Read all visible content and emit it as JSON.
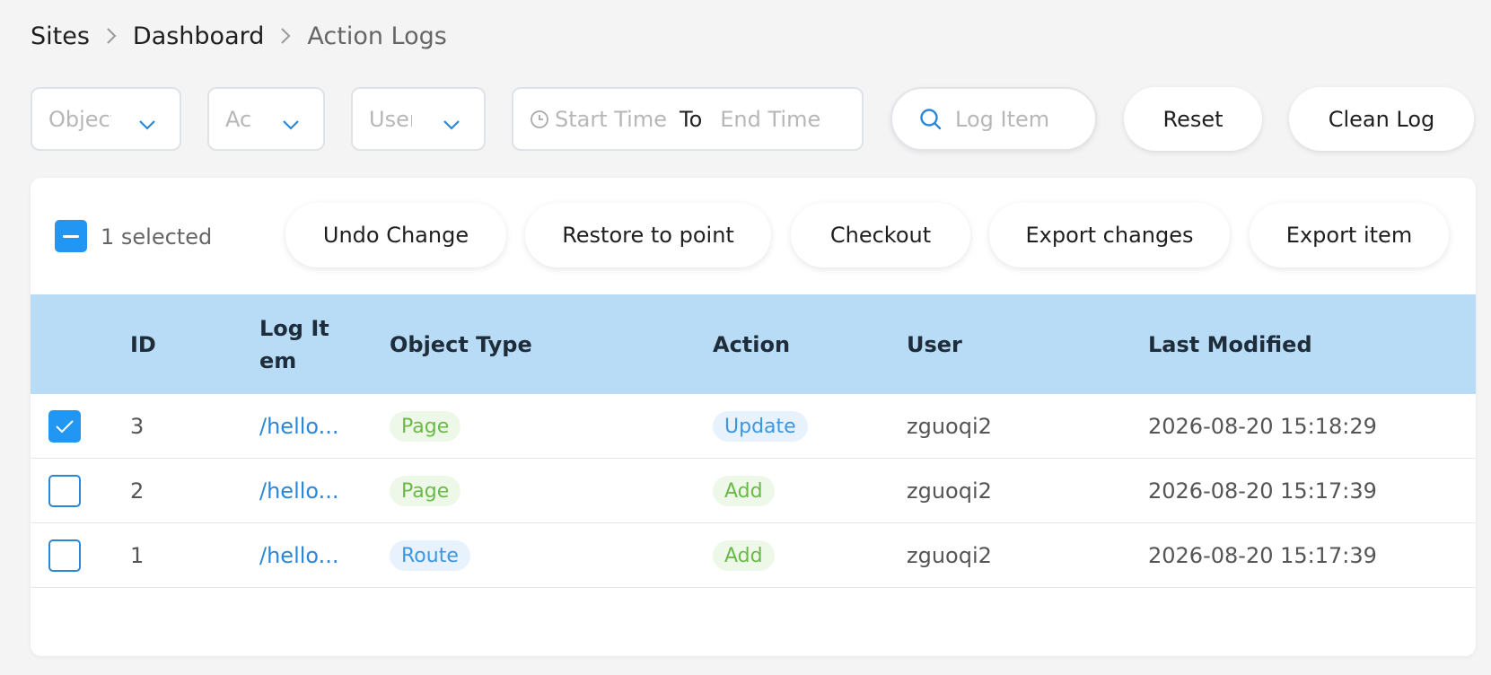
{
  "breadcrumb": {
    "items": [
      "Sites",
      "Dashboard",
      "Action Logs"
    ]
  },
  "filters": {
    "object_type_placeholder": "Object Type",
    "action_placeholder": "Action",
    "user_placeholder": "User",
    "start_time_placeholder": "Start Time",
    "range_separator": "To",
    "end_time_placeholder": "End Time",
    "search_placeholder": "Log Item",
    "reset_label": "Reset",
    "clean_log_label": "Clean Log"
  },
  "selection": {
    "text": "1 selected"
  },
  "actions": {
    "undo_change": "Undo Change",
    "restore_to_point": "Restore to point",
    "checkout": "Checkout",
    "export_changes": "Export changes",
    "export_item": "Export item"
  },
  "table": {
    "columns": {
      "id": "ID",
      "log_item": "Log Item",
      "object_type": "Object Type",
      "action": "Action",
      "user": "User",
      "last_modified": "Last Modified"
    },
    "rows": [
      {
        "checked": true,
        "id": "3",
        "log_item": "/hello...",
        "object_type": "Page",
        "object_type_color": "green",
        "action": "Update",
        "action_color": "blue",
        "user": "zguoqi2",
        "last_modified": "2026-08-20 15:18:29"
      },
      {
        "checked": false,
        "id": "2",
        "log_item": "/hello...",
        "object_type": "Page",
        "object_type_color": "green",
        "action": "Add",
        "action_color": "green",
        "user": "zguoqi2",
        "last_modified": "2026-08-20 15:17:39"
      },
      {
        "checked": false,
        "id": "1",
        "log_item": "/hello...",
        "object_type": "Route",
        "object_type_color": "blue",
        "action": "Add",
        "action_color": "green",
        "user": "zguoqi2",
        "last_modified": "2026-08-20 15:17:39"
      }
    ]
  },
  "colors": {
    "accent": "#2196f3",
    "link": "#2b87d8",
    "header_bg": "#b8dbf6",
    "tag_green": "#6bb94a",
    "tag_blue": "#3d97e0"
  }
}
